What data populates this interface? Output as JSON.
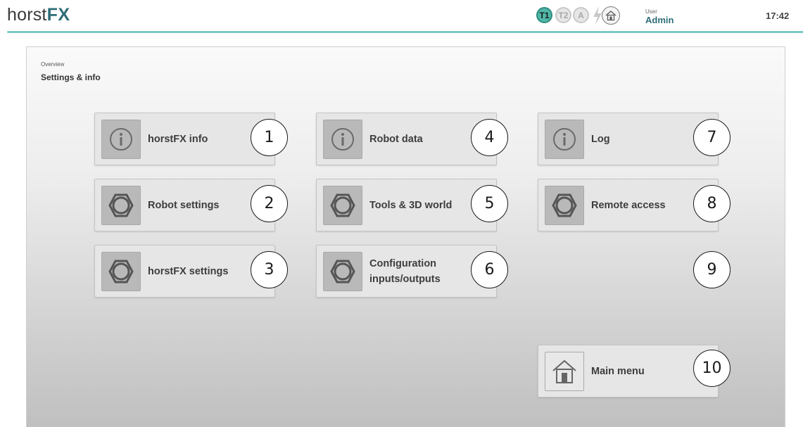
{
  "header": {
    "logo_light": "horst",
    "logo_bold": "FX",
    "modes": [
      "T1",
      "T2",
      "A"
    ],
    "active_mode": "T1",
    "user_label": "User",
    "user_name": "Admin",
    "time": "17:42",
    "accent_color": "#50b7a8"
  },
  "breadcrumb": {
    "parent": "Overview",
    "title": "Settings & info"
  },
  "tiles": [
    {
      "label": "horstFX info",
      "icon": "info-icon",
      "number": "1"
    },
    {
      "label": "Robot settings",
      "icon": "gear-icon",
      "number": "2"
    },
    {
      "label": "horstFX settings",
      "icon": "gear-icon",
      "number": "3"
    },
    {
      "label": "Robot data",
      "icon": "info-icon",
      "number": "4"
    },
    {
      "label": "Tools & 3D world",
      "icon": "gear-icon",
      "number": "5"
    },
    {
      "label": "Configuration inputs/outputs",
      "icon": "gear-icon",
      "number": "6"
    },
    {
      "label": "Log",
      "icon": "info-icon",
      "number": "7"
    },
    {
      "label": "Remote access",
      "icon": "gear-icon",
      "number": "8"
    },
    {
      "label": "Main menu",
      "icon": "home-icon",
      "number": "10"
    }
  ],
  "markers": [
    "9"
  ]
}
